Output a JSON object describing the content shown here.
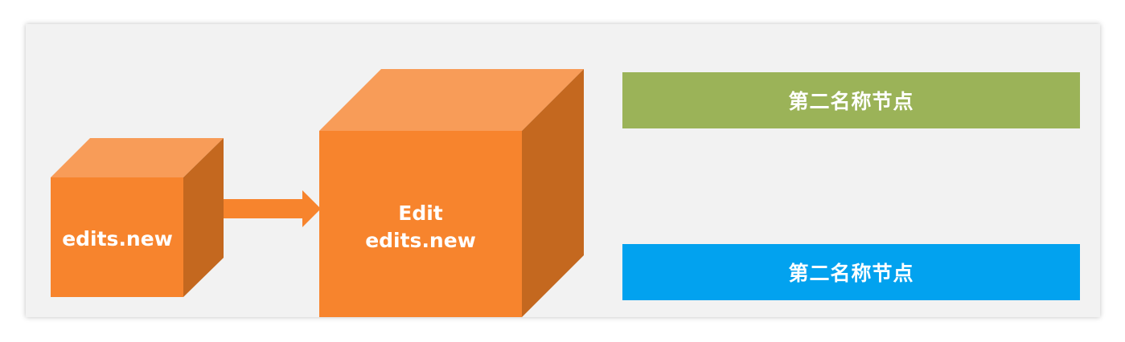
{
  "cubes": {
    "small": {
      "label": "edits.new"
    },
    "large": {
      "line1": "Edit",
      "line2": "edits.new"
    }
  },
  "nodes": {
    "top": {
      "label": "第二名称节点"
    },
    "bottom": {
      "label": "第二名称节点"
    }
  },
  "colors": {
    "cube_front": "#f7842d",
    "cube_top": "#f89c58",
    "cube_side": "#c4681f",
    "arrow": "#f7842d",
    "node_green": "#9bb358",
    "node_blue": "#02a2ef",
    "background": "#f2f2f2"
  }
}
